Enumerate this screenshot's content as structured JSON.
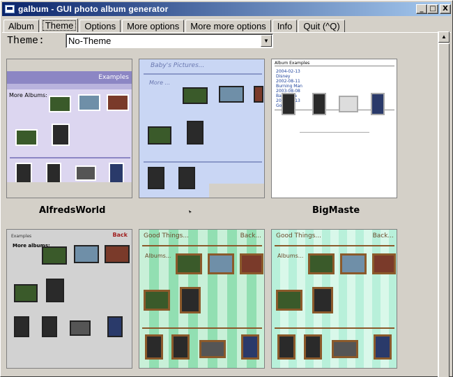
{
  "window": {
    "title": "galbum - GUI photo album generator",
    "controls": {
      "minimize": "_",
      "maximize": "□",
      "close": "X"
    }
  },
  "tabs": [
    {
      "label": "Album",
      "active": false
    },
    {
      "label": "Theme",
      "active": true
    },
    {
      "label": "Options",
      "active": false
    },
    {
      "label": "More options",
      "active": false
    },
    {
      "label": "More more options",
      "active": false
    },
    {
      "label": "Info",
      "active": false
    },
    {
      "label": "Quit  (^Q)",
      "active": false
    }
  ],
  "theme_selector": {
    "label": "Theme:",
    "value": "No-Theme",
    "arrow": "▼"
  },
  "scrollbar": {
    "up_arrow": "▲"
  },
  "themes": [
    {
      "caption": "AlfredsWorld",
      "header": "Examples",
      "subhead": "More Albums:"
    },
    {
      "caption": "",
      "header": "Baby's Pictures...",
      "subhead": "More ..."
    },
    {
      "caption": "BigMaste",
      "header": "Album  Examples",
      "subhead": ""
    },
    {
      "caption": "",
      "header": "Examples",
      "subhead": "More albums:",
      "link": "Back"
    },
    {
      "caption": "",
      "header": "Good Things...",
      "subhead": "Albums...",
      "link": "Back..."
    },
    {
      "caption": "",
      "header": "Good Things...",
      "subhead": "Albums...",
      "link": "Back..."
    }
  ],
  "icons": {
    "app": "photo-album-icon",
    "dropdown": "chevron-down-icon",
    "scroll": "arrow-up-icon"
  }
}
